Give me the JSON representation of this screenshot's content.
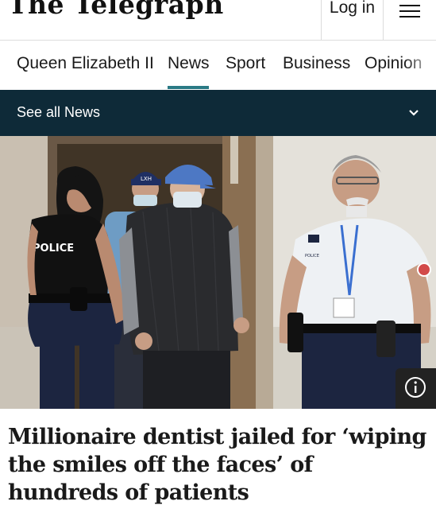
{
  "header": {
    "masthead": "The Telegraph",
    "login_label": "Log in",
    "menu_icon": "hamburger-menu-icon"
  },
  "nav": {
    "items": [
      {
        "label": "Queen Elizabeth II",
        "active": false
      },
      {
        "label": "News",
        "active": true
      },
      {
        "label": "Sport",
        "active": false
      },
      {
        "label": "Business",
        "active": false
      },
      {
        "label": "Opinion",
        "active": false
      }
    ],
    "accent_color": "#2a7a85"
  },
  "section_bar": {
    "label": "See all News",
    "icon": "chevron-down-icon",
    "background": "#0e2a38"
  },
  "hero_image": {
    "vest_labels": [
      "POLICE",
      "POLICE"
    ],
    "cap_text": "LXH",
    "info_icon": "info-icon"
  },
  "article": {
    "headline": "Millionaire dentist jailed for ‘wiping the smiles off the faces’ of hundreds of patients"
  }
}
